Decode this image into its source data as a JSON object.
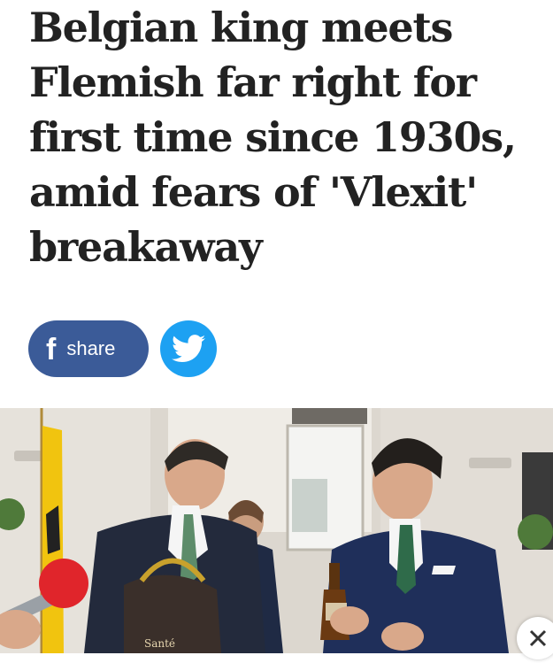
{
  "article": {
    "headline_lines": [
      "Belgian king meets",
      "Flemish far right for",
      "first time since 1930s,",
      "amid fears of 'Vlexit'",
      "breakaway"
    ]
  },
  "share": {
    "facebook_glyph": "f",
    "facebook_label": "share",
    "facebook_icon": "facebook-f-icon",
    "twitter_icon": "twitter-bird-icon"
  },
  "photo": {
    "basket_label": "Santé"
  },
  "overlay": {
    "close_icon": "close-icon"
  },
  "colors": {
    "headline": "#222222",
    "facebook": "#3b5b98",
    "twitter": "#1da1f2"
  }
}
